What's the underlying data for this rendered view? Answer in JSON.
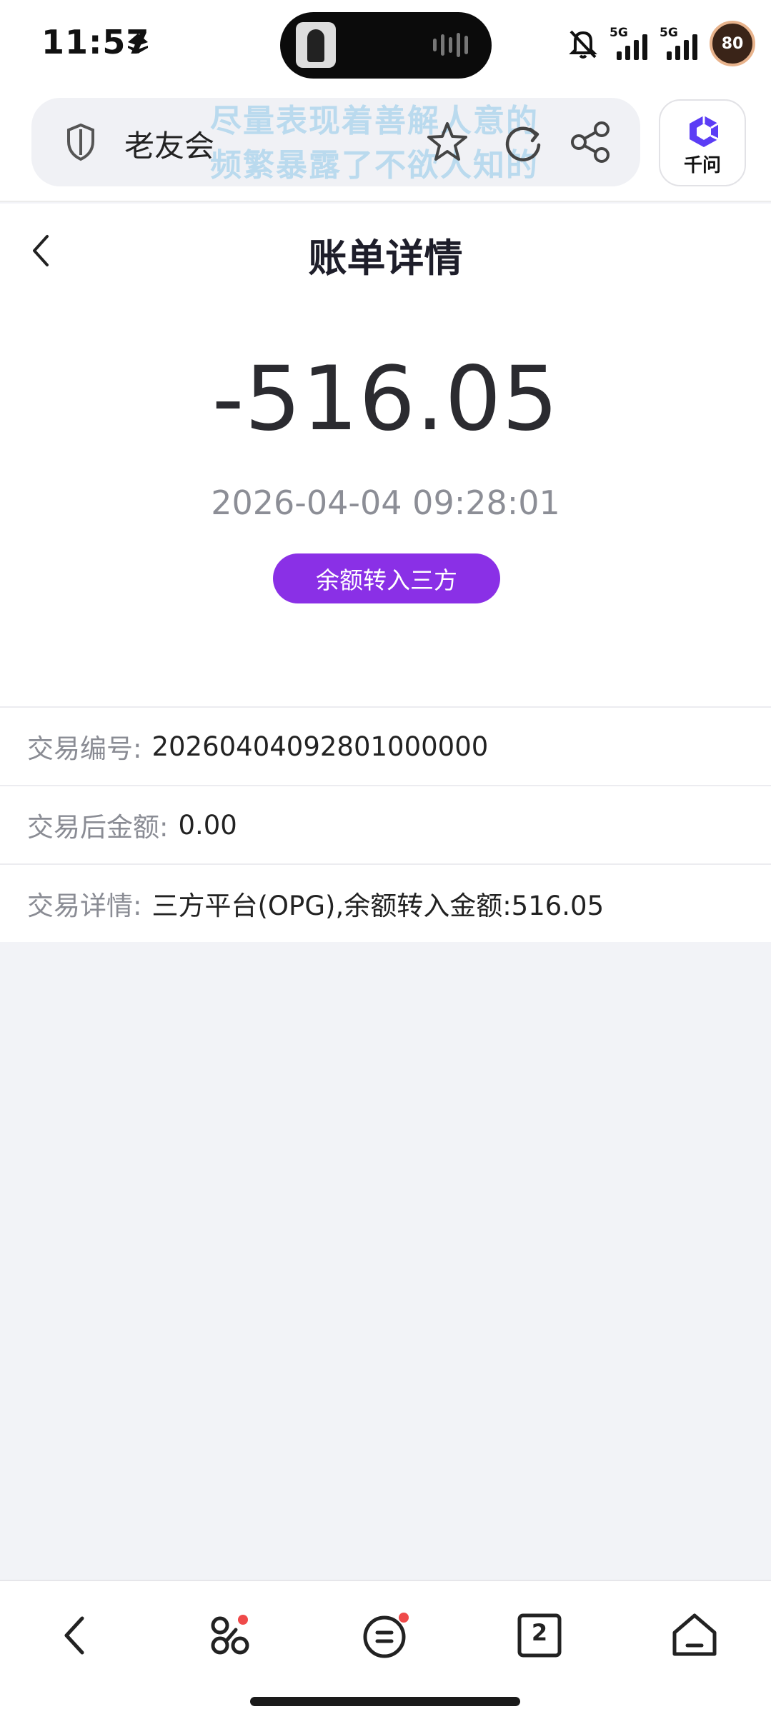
{
  "status_bar": {
    "time": "11:57",
    "network_1": "5G",
    "network_2": "5G",
    "battery": "80",
    "icons": [
      "location-arrow-icon",
      "mute-icon",
      "signal-icon",
      "battery-icon"
    ]
  },
  "browser": {
    "site_name": "老友会",
    "watermark_line1": "尽量表现着善解人意的",
    "watermark_line2": "频繁暴露了不欲人知的",
    "assistant_label": "千问",
    "accent_color": "#5b3df5"
  },
  "page": {
    "title": "账单详情"
  },
  "bill": {
    "amount": "-516.05",
    "datetime": "2026-04-04 09:28:01",
    "type_badge": "余额转入三方",
    "badge_color": "#8a30e6"
  },
  "details": [
    {
      "key": "交易编号:",
      "value": "20260404092801000000"
    },
    {
      "key": "交易后金额:",
      "value": "0.00"
    },
    {
      "key": "交易详情:",
      "value": "三方平台(OPG),余额转入金额:516.05"
    }
  ],
  "bottom_nav": {
    "tab_count": "2"
  }
}
